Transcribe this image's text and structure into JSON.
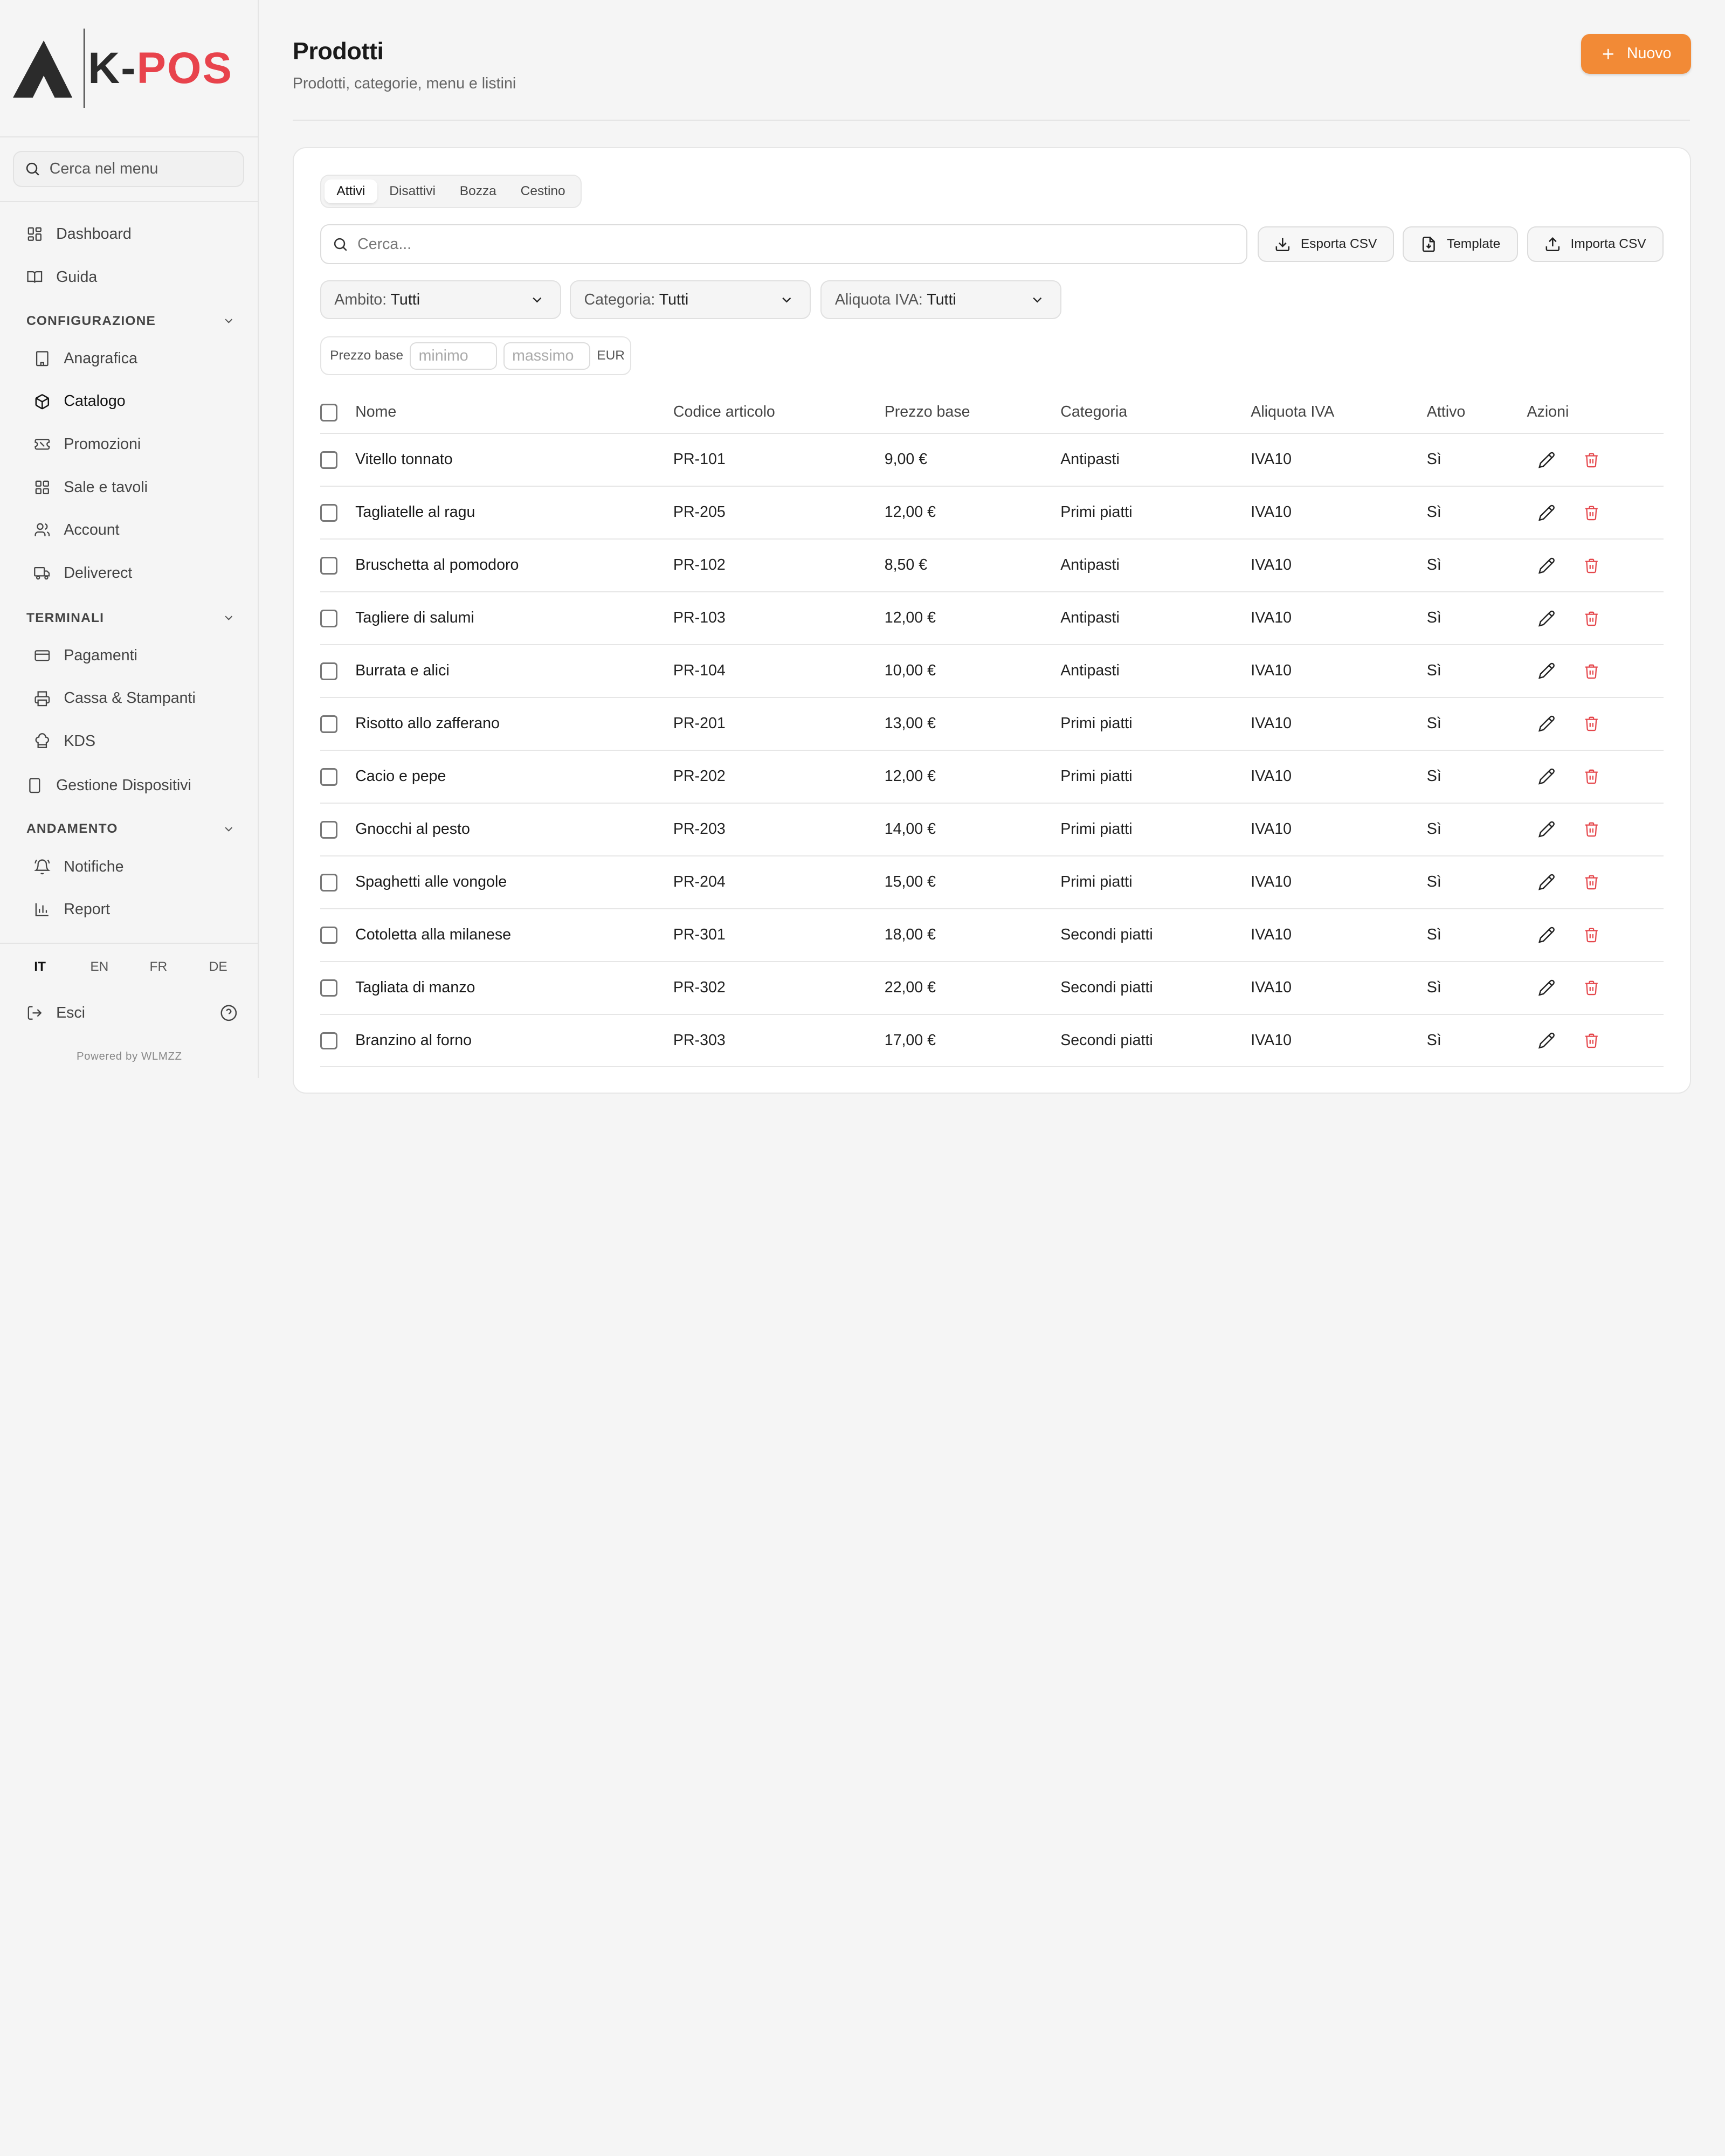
{
  "brand": {
    "name_k": "K-",
    "name_pos": "POS"
  },
  "sidebar": {
    "search_placeholder": "Cerca nel menu",
    "items_top": [
      {
        "label": "Dashboard",
        "icon": "grid-icon"
      },
      {
        "label": "Guida",
        "icon": "book-icon"
      }
    ],
    "sections": [
      {
        "title": "CONFIGURAZIONE"
      },
      {
        "title": "TERMINALI"
      },
      {
        "title": "ANDAMENTO"
      }
    ],
    "config_items": [
      "Anagrafica",
      "Catalogo",
      "Promozioni",
      "Sale e tavoli",
      "Account",
      "Deliverect"
    ],
    "terminal_items": [
      "Pagamenti",
      "Cassa & Stampanti",
      "KDS"
    ],
    "device_item": "Gestione Dispositivi",
    "andamento_items": [
      "Notifiche",
      "Report"
    ],
    "active_item": "Catalogo",
    "languages": [
      "IT",
      "EN",
      "FR",
      "DE"
    ],
    "active_language": "IT",
    "logout_label": "Esci",
    "powered_by": "Powered by WLMZZ"
  },
  "header": {
    "title": "Prodotti",
    "subtitle": "Prodotti, categorie, menu e listini",
    "new_button": "Nuovo"
  },
  "tabs": [
    "Attivi",
    "Disattivi",
    "Bozza",
    "Cestino"
  ],
  "active_tab": "Attivi",
  "toolbar": {
    "search_placeholder": "Cerca...",
    "export_label": "Esporta CSV",
    "template_label": "Template",
    "import_label": "Importa CSV"
  },
  "filters": [
    {
      "label": "Ambito:",
      "value": "Tutti"
    },
    {
      "label": "Categoria:",
      "value": "Tutti"
    },
    {
      "label": "Aliquota IVA:",
      "value": "Tutti"
    }
  ],
  "price_filter": {
    "label": "Prezzo base",
    "min_placeholder": "minimo",
    "max_placeholder": "massimo",
    "currency": "EUR"
  },
  "table": {
    "columns": [
      "Nome",
      "Codice articolo",
      "Prezzo base",
      "Categoria",
      "Aliquota IVA",
      "Attivo",
      "Azioni"
    ],
    "rows": [
      {
        "name": "Vitello tonnato",
        "code": "PR-101",
        "price": "9,00 €",
        "category": "Antipasti",
        "vat": "IVA10",
        "active": "Sì"
      },
      {
        "name": "Tagliatelle al ragu",
        "code": "PR-205",
        "price": "12,00 €",
        "category": "Primi piatti",
        "vat": "IVA10",
        "active": "Sì"
      },
      {
        "name": "Bruschetta al pomodoro",
        "code": "PR-102",
        "price": "8,50 €",
        "category": "Antipasti",
        "vat": "IVA10",
        "active": "Sì"
      },
      {
        "name": "Tagliere di salumi",
        "code": "PR-103",
        "price": "12,00 €",
        "category": "Antipasti",
        "vat": "IVA10",
        "active": "Sì"
      },
      {
        "name": "Burrata e alici",
        "code": "PR-104",
        "price": "10,00 €",
        "category": "Antipasti",
        "vat": "IVA10",
        "active": "Sì"
      },
      {
        "name": "Risotto allo zafferano",
        "code": "PR-201",
        "price": "13,00 €",
        "category": "Primi piatti",
        "vat": "IVA10",
        "active": "Sì"
      },
      {
        "name": "Cacio e pepe",
        "code": "PR-202",
        "price": "12,00 €",
        "category": "Primi piatti",
        "vat": "IVA10",
        "active": "Sì"
      },
      {
        "name": "Gnocchi al pesto",
        "code": "PR-203",
        "price": "14,00 €",
        "category": "Primi piatti",
        "vat": "IVA10",
        "active": "Sì"
      },
      {
        "name": "Spaghetti alle vongole",
        "code": "PR-204",
        "price": "15,00 €",
        "category": "Primi piatti",
        "vat": "IVA10",
        "active": "Sì"
      },
      {
        "name": "Cotoletta alla milanese",
        "code": "PR-301",
        "price": "18,00 €",
        "category": "Secondi piatti",
        "vat": "IVA10",
        "active": "Sì"
      },
      {
        "name": "Tagliata di manzo",
        "code": "PR-302",
        "price": "22,00 €",
        "category": "Secondi piatti",
        "vat": "IVA10",
        "active": "Sì"
      },
      {
        "name": "Branzino al forno",
        "code": "PR-303",
        "price": "17,00 €",
        "category": "Secondi piatti",
        "vat": "IVA10",
        "active": "Sì"
      }
    ]
  },
  "colors": {
    "accent": "#f28a36",
    "brand_red": "#e8434c",
    "delete": "#e5484d"
  }
}
